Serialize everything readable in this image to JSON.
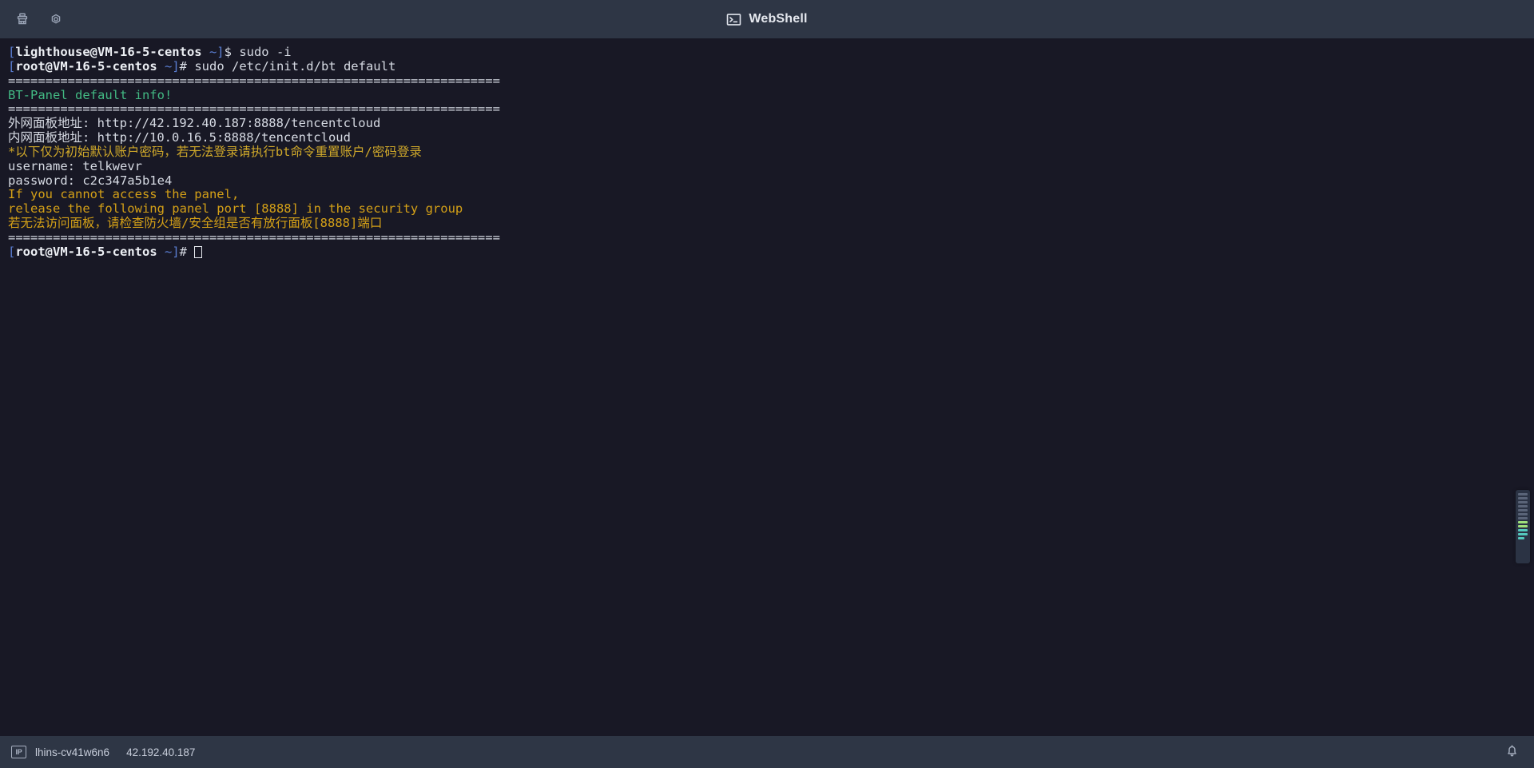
{
  "header": {
    "title": "WebShell",
    "title_icon": "terminal-icon",
    "tools": [
      {
        "name": "clear-screen-button",
        "icon": "broom-icon",
        "label": ""
      },
      {
        "name": "settings-button",
        "icon": "gear-icon",
        "label": ""
      }
    ]
  },
  "terminal": {
    "colors": {
      "background": "#181825",
      "foreground": "#d6dae3",
      "green": "#42b983",
      "yellow": "#cfa82a",
      "blue": "#5b7fd4",
      "cyan": "#3fb6c8",
      "magenta": "#b06ad6",
      "red": "#cc5555"
    },
    "lines": [
      {
        "id": "l1",
        "segs": [
          {
            "t": "[",
            "c": "c-blue"
          },
          {
            "t": "lighthouse@VM-16-5-centos",
            "c": "c-bwhite"
          },
          {
            "t": " ~]",
            "c": "c-blue"
          },
          {
            "t": "$ ",
            "c": "c-white"
          },
          {
            "t": "sudo -i",
            "c": "c-white"
          }
        ]
      },
      {
        "id": "l2",
        "segs": [
          {
            "t": "[",
            "c": "c-blue"
          },
          {
            "t": "root@VM-16-5-centos",
            "c": "c-bwhite"
          },
          {
            "t": " ~]",
            "c": "c-blue"
          },
          {
            "t": "# ",
            "c": "c-white"
          },
          {
            "t": "sudo /etc/init.d/bt default",
            "c": "c-white"
          }
        ]
      },
      {
        "id": "l3",
        "segs": [
          {
            "t": "==================================================================",
            "c": "c-sep"
          }
        ]
      },
      {
        "id": "l4",
        "segs": [
          {
            "t": "BT-Panel default info!",
            "c": "c-green"
          }
        ]
      },
      {
        "id": "l5",
        "segs": [
          {
            "t": "==================================================================",
            "c": "c-sep"
          }
        ]
      },
      {
        "id": "l6",
        "segs": [
          {
            "t": "外网面板地址: ",
            "c": "c-white"
          },
          {
            "t": "http://42.192.40.187:8888/tencentcloud",
            "c": "c-white"
          }
        ]
      },
      {
        "id": "l7",
        "segs": [
          {
            "t": "内网面板地址: ",
            "c": "c-white"
          },
          {
            "t": "http://10.0.16.5:8888/tencentcloud",
            "c": "c-white"
          }
        ]
      },
      {
        "id": "l8",
        "segs": [
          {
            "t": "*以下仅为初始默认账户密码，若无法登录请执行bt命令重置账户/密码登录",
            "c": "c-yellow"
          }
        ]
      },
      {
        "id": "l9",
        "segs": [
          {
            "t": "username: telkwevr",
            "c": "c-white"
          }
        ]
      },
      {
        "id": "l10",
        "segs": [
          {
            "t": "password: c2c347a5b1e4",
            "c": "c-white"
          }
        ]
      },
      {
        "id": "l11",
        "segs": [
          {
            "t": "If you cannot access the panel,",
            "c": "c-oyellow"
          }
        ]
      },
      {
        "id": "l12",
        "segs": [
          {
            "t": "release the following panel port [8888] in the security group",
            "c": "c-oyellow"
          }
        ]
      },
      {
        "id": "l13",
        "segs": [
          {
            "t": "若无法访问面板，请检查防火墙/安全组是否有放行面板[8888]端口",
            "c": "c-oyellow"
          }
        ]
      },
      {
        "id": "l14",
        "segs": [
          {
            "t": "==================================================================",
            "c": "c-sep"
          }
        ]
      },
      {
        "id": "l15",
        "segs": [
          {
            "t": "[",
            "c": "c-blue"
          },
          {
            "t": "root@VM-16-5-centos",
            "c": "c-bwhite"
          },
          {
            "t": " ~]",
            "c": "c-blue"
          },
          {
            "t": "# ",
            "c": "c-white"
          }
        ],
        "cursor": true
      }
    ]
  },
  "minimap": {
    "name": "scroll-minimap",
    "marks": [
      {
        "color": "#5a6478",
        "w": "100%"
      },
      {
        "color": "#5a6478",
        "w": "100%"
      },
      {
        "color": "#5a6478",
        "w": "100%"
      },
      {
        "color": "#5a6478",
        "w": "100%"
      },
      {
        "color": "#5a6478",
        "w": "100%"
      },
      {
        "color": "#5a6478",
        "w": "100%"
      },
      {
        "color": "#5a6478",
        "w": "100%"
      },
      {
        "color": "#9ee07a",
        "w": "100%"
      },
      {
        "color": "#9ee07a",
        "w": "100%"
      },
      {
        "color": "#54c8bd",
        "w": "100%"
      },
      {
        "color": "#54c8bd",
        "w": "100%"
      },
      {
        "color": "#54c8bd",
        "w": "70%"
      }
    ]
  },
  "status": {
    "ip_badge_label": "IP",
    "instance_name": "lhins-cv41w6n6",
    "ip_address": "42.192.40.187",
    "notification_icon": "bell-icon"
  }
}
